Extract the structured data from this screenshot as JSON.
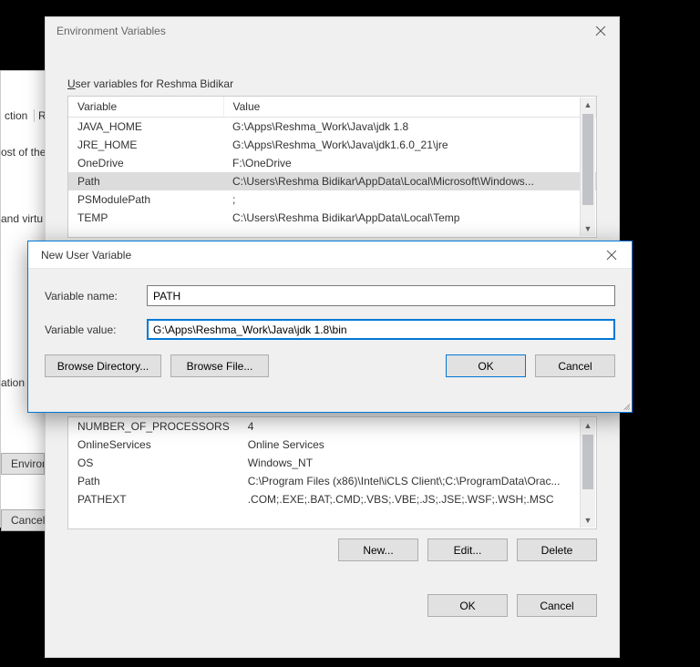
{
  "background": {
    "frag1": "ction",
    "frag2": "R",
    "line1": "ost of the",
    "line2": "and virtu",
    "line3": "ation",
    "btn_env": "Environm",
    "btn_cancel": "Cancel"
  },
  "env": {
    "title": "Environment Variables",
    "user_section_label_pre": "U",
    "user_section_label_post": "ser variables for Reshma Bidikar",
    "columns": {
      "variable": "Variable",
      "value": "Value"
    },
    "user_vars": [
      {
        "name": "JAVA_HOME",
        "value": "G:\\Apps\\Reshma_Work\\Java\\jdk 1.8",
        "selected": false
      },
      {
        "name": "JRE_HOME",
        "value": "G:\\Apps\\Reshma_Work\\Java\\jdk1.6.0_21\\jre",
        "selected": false
      },
      {
        "name": "OneDrive",
        "value": "F:\\OneDrive",
        "selected": false
      },
      {
        "name": "Path",
        "value": "C:\\Users\\Reshma Bidikar\\AppData\\Local\\Microsoft\\Windows...",
        "selected": true
      },
      {
        "name": "PSModulePath",
        "value": ";",
        "selected": false
      },
      {
        "name": "TEMP",
        "value": "C:\\Users\\Reshma Bidikar\\AppData\\Local\\Temp",
        "selected": false
      }
    ],
    "sys_vars": [
      {
        "name": "NUMBER_OF_PROCESSORS",
        "value": "4"
      },
      {
        "name": "OnlineServices",
        "value": "Online Services"
      },
      {
        "name": "OS",
        "value": "Windows_NT"
      },
      {
        "name": "Path",
        "value": "C:\\Program Files (x86)\\Intel\\iCLS Client\\;C:\\ProgramData\\Orac..."
      },
      {
        "name": "PATHEXT",
        "value": ".COM;.EXE;.BAT;.CMD;.VBS;.VBE;.JS;.JSE;.WSF;.WSH;.MSC"
      }
    ],
    "buttons": {
      "new": "New...",
      "edit": "Edit...",
      "delete": "Delete",
      "ok": "OK",
      "cancel": "Cancel"
    }
  },
  "dialog": {
    "title": "New User Variable",
    "name_label": "Variable name:",
    "value_label": "Variable value:",
    "name_value": "PATH",
    "value_value": "G:\\Apps\\Reshma_Work\\Java\\jdk 1.8\\bin",
    "browse_dir": "Browse Directory...",
    "browse_file": "Browse File...",
    "ok": "OK",
    "cancel": "Cancel"
  }
}
